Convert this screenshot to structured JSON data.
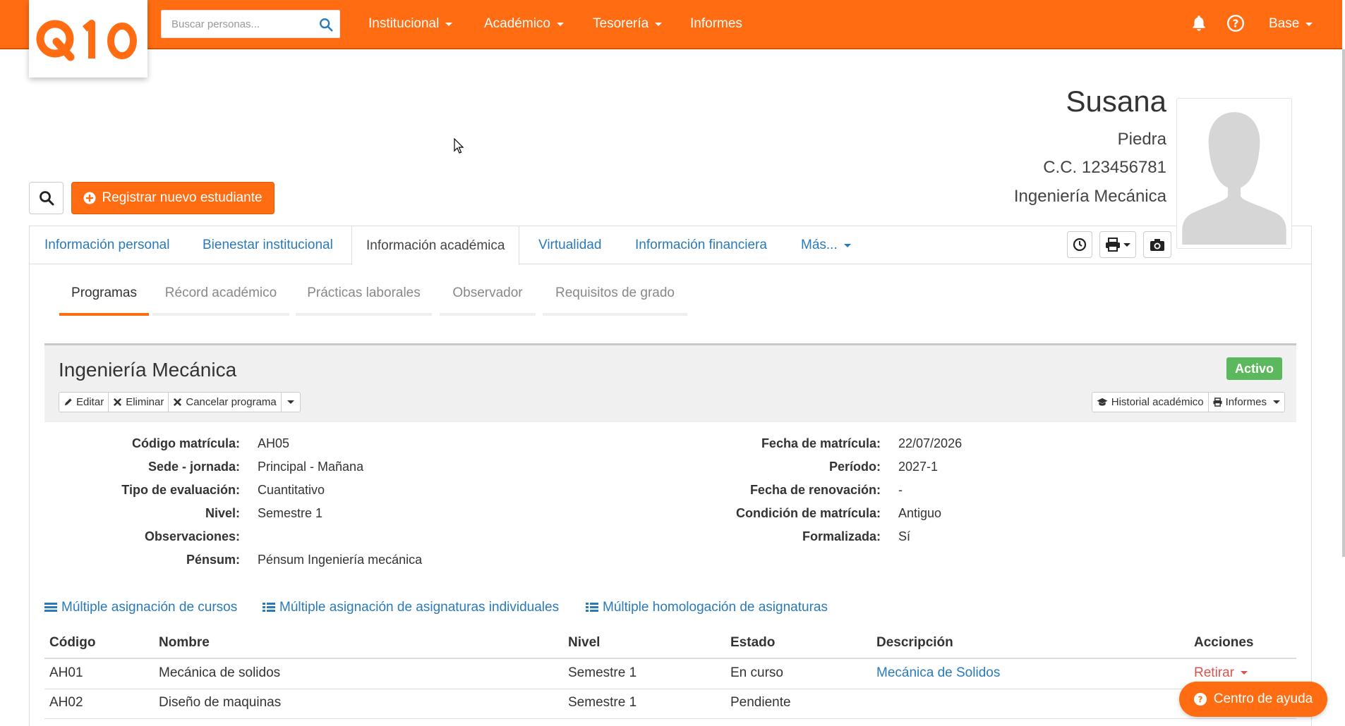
{
  "brand": {
    "logo_text": "Q10",
    "accent": "#ff6c12",
    "link_color": "#2a7ab9"
  },
  "topbar": {
    "search_placeholder": "Buscar personas...",
    "menu": [
      {
        "label": "Institucional",
        "dropdown": true
      },
      {
        "label": "Académico",
        "dropdown": true
      },
      {
        "label": "Tesorería",
        "dropdown": true
      },
      {
        "label": "Informes",
        "dropdown": false
      }
    ],
    "user_label": "Base",
    "icons": [
      "bell-icon",
      "help-circle-icon"
    ]
  },
  "student": {
    "first_name": "Susana",
    "last_name": "Piedra",
    "id_doc": "C.C. 123456781",
    "program": "Ingeniería Mecánica"
  },
  "actions": {
    "register_label": "Registrar nuevo estudiante"
  },
  "tabs": [
    {
      "label": "Información personal",
      "active": false
    },
    {
      "label": "Bienestar institucional",
      "active": false
    },
    {
      "label": "Información académica",
      "active": true
    },
    {
      "label": "Virtualidad",
      "active": false
    },
    {
      "label": "Información financiera",
      "active": false
    },
    {
      "label": "Más...",
      "active": false
    }
  ],
  "subtabs": [
    {
      "label": "Programas",
      "active": true
    },
    {
      "label": "Récord académico",
      "active": false
    },
    {
      "label": "Prácticas laborales",
      "active": false
    },
    {
      "label": "Observador",
      "active": false
    },
    {
      "label": "Requisitos de grado",
      "active": false
    }
  ],
  "program_box": {
    "title": "Ingeniería Mecánica",
    "status": "Activo",
    "left_buttons": {
      "edit": "Editar",
      "delete": "Eliminar",
      "cancel": "Cancelar programa"
    },
    "right_buttons": {
      "history": "Historial académico",
      "reports": "Informes"
    }
  },
  "details_left": [
    {
      "label": "Código matrícula:",
      "value": "AH05"
    },
    {
      "label": "Sede - jornada:",
      "value": "Principal - Mañana"
    },
    {
      "label": "Tipo de evaluación:",
      "value": "Cuantitativo"
    },
    {
      "label": "Nivel:",
      "value": "Semestre 1"
    },
    {
      "label": "Observaciones:",
      "value": ""
    },
    {
      "label": "Pénsum:",
      "value": "Pénsum Ingeniería mecánica"
    }
  ],
  "details_right": [
    {
      "label": "Fecha de matrícula:",
      "value": "22/07/2026"
    },
    {
      "label": "Período:",
      "value": "2027-1"
    },
    {
      "label": "Fecha de renovación:",
      "value": "-"
    },
    {
      "label": "Condición de matrícula:",
      "value": "Antiguo"
    },
    {
      "label": "Formalizada:",
      "value": "Sí"
    }
  ],
  "links": [
    "Múltiple asignación de cursos",
    "Múltiple asignación de asignaturas individuales",
    "Múltiple homologación de asignaturas"
  ],
  "table": {
    "headers": [
      "Código",
      "Nombre",
      "Nivel",
      "Estado",
      "Descripción",
      "Acciones"
    ],
    "rows": [
      {
        "code": "AH01",
        "name": "Mecánica de solidos",
        "level": "Semestre 1",
        "state": "En curso",
        "description": "Mecánica de Solidos",
        "action": "Retirar"
      },
      {
        "code": "AH02",
        "name": "Diseño de maquinas",
        "level": "Semestre 1",
        "state": "Pendiente",
        "description": "",
        "action": ""
      }
    ]
  },
  "help_button": "Centro de ayuda"
}
